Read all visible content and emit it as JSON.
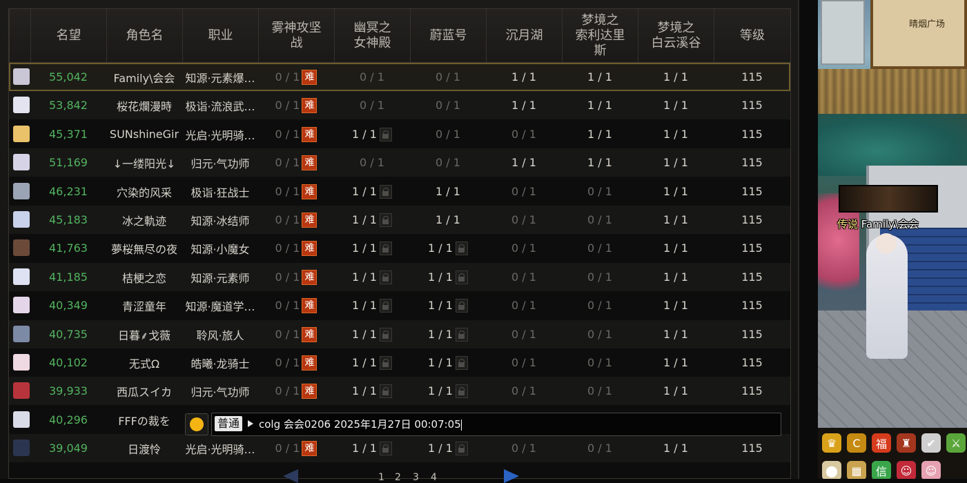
{
  "table": {
    "headers": [
      {
        "key": "avatar",
        "label": ""
      },
      {
        "key": "fame",
        "label": "名望"
      },
      {
        "key": "name",
        "label": "角色名"
      },
      {
        "key": "job",
        "label": "职业"
      },
      {
        "key": "d1",
        "label": "雾神攻坚\n战"
      },
      {
        "key": "d2",
        "label": "幽冥之\n女神殿"
      },
      {
        "key": "d3",
        "label": "蔚蓝号"
      },
      {
        "key": "d4",
        "label": "沉月湖"
      },
      {
        "key": "d5",
        "label": "梦境之\n索利达里\n斯"
      },
      {
        "key": "d6",
        "label": "梦境之\n白云溪谷"
      },
      {
        "key": "level",
        "label": "等级"
      }
    ],
    "rows": [
      {
        "fame": "55,042",
        "name": "Family\\会会",
        "job": "知源·元素爆…",
        "d1": "0 / 1",
        "d1_badge": "hard",
        "d2": "0 / 1",
        "d2_badge": "",
        "d3": "0 / 1",
        "d3_badge": "",
        "d4": "1 / 1",
        "d4_badge": "",
        "d5": "1 / 1",
        "d6": "1 / 1",
        "level": "115",
        "avatar_color": "#c9c6d6",
        "selected": true
      },
      {
        "fame": "53,842",
        "name": "桜花爛漫時",
        "job": "极诣·流浪武…",
        "d1": "0 / 1",
        "d1_badge": "hard",
        "d2": "0 / 1",
        "d2_badge": "",
        "d3": "0 / 1",
        "d3_badge": "",
        "d4": "1 / 1",
        "d4_badge": "",
        "d5": "1 / 1",
        "d6": "1 / 1",
        "level": "115",
        "avatar_color": "#e3e4ef"
      },
      {
        "fame": "45,371",
        "name": "SUNshineGir",
        "job": "光启·光明骑…",
        "d1": "0 / 1",
        "d1_badge": "hard",
        "d2": "1 / 1",
        "d2_badge": "lock",
        "d3": "0 / 1",
        "d3_badge": "",
        "d4": "0 / 1",
        "d4_badge": "",
        "d5": "1 / 1",
        "d6": "1 / 1",
        "level": "115",
        "avatar_color": "#e9c26a"
      },
      {
        "fame": "51,169",
        "name": "↓一缕阳光↓",
        "job": "归元·气功师",
        "d1": "0 / 1",
        "d1_badge": "hard",
        "d2": "0 / 1",
        "d2_badge": "",
        "d3": "0 / 1",
        "d3_badge": "",
        "d4": "1 / 1",
        "d4_badge": "",
        "d5": "1 / 1",
        "d6": "1 / 1",
        "level": "115",
        "avatar_color": "#d7d3e6"
      },
      {
        "fame": "46,231",
        "name": "穴染的风采",
        "job": "极诣·狂战士",
        "d1": "0 / 1",
        "d1_badge": "hard",
        "d2": "1 / 1",
        "d2_badge": "lock",
        "d3": "1 / 1",
        "d3_badge": "",
        "d4": "0 / 1",
        "d4_badge": "",
        "d5": "0 / 1",
        "d6": "1 / 1",
        "level": "115",
        "avatar_color": "#9aa4b5"
      },
      {
        "fame": "45,183",
        "name": "冰之軌迹",
        "job": "知源·冰结师",
        "d1": "0 / 1",
        "d1_badge": "hard",
        "d2": "1 / 1",
        "d2_badge": "lock",
        "d3": "1 / 1",
        "d3_badge": "",
        "d4": "0 / 1",
        "d4_badge": "",
        "d5": "0 / 1",
        "d6": "1 / 1",
        "level": "115",
        "avatar_color": "#c8d2ea"
      },
      {
        "fame": "41,763",
        "name": "夢桜無尽の夜",
        "job": "知源·小魔女",
        "d1": "0 / 1",
        "d1_badge": "hard",
        "d2": "1 / 1",
        "d2_badge": "lock",
        "d3": "1 / 1",
        "d3_badge": "lock",
        "d4": "0 / 1",
        "d4_badge": "",
        "d5": "0 / 1",
        "d6": "1 / 1",
        "level": "115",
        "avatar_color": "#6b4a3a"
      },
      {
        "fame": "41,185",
        "name": "桔梗之恋",
        "job": "知源·元素师",
        "d1": "0 / 1",
        "d1_badge": "hard",
        "d2": "1 / 1",
        "d2_badge": "lock",
        "d3": "1 / 1",
        "d3_badge": "lock",
        "d4": "0 / 1",
        "d4_badge": "",
        "d5": "0 / 1",
        "d6": "1 / 1",
        "level": "115",
        "avatar_color": "#dfe2f2"
      },
      {
        "fame": "40,349",
        "name": "青涩童年",
        "job": "知源·魔道学…",
        "d1": "0 / 1",
        "d1_badge": "hard",
        "d2": "1 / 1",
        "d2_badge": "lock",
        "d3": "1 / 1",
        "d3_badge": "lock",
        "d4": "0 / 1",
        "d4_badge": "",
        "d5": "0 / 1",
        "d6": "1 / 1",
        "level": "115",
        "avatar_color": "#e4d6e8"
      },
      {
        "fame": "40,735",
        "name": "日暮⸙戈薇",
        "job": "聆风·旅人",
        "d1": "0 / 1",
        "d1_badge": "hard",
        "d2": "1 / 1",
        "d2_badge": "lock",
        "d3": "1 / 1",
        "d3_badge": "lock",
        "d4": "0 / 1",
        "d4_badge": "",
        "d5": "0 / 1",
        "d6": "1 / 1",
        "level": "115",
        "avatar_color": "#7d8aa6"
      },
      {
        "fame": "40,102",
        "name": "无式Ω",
        "job": "皓曦·龙骑士",
        "d1": "0 / 1",
        "d1_badge": "hard",
        "d2": "1 / 1",
        "d2_badge": "lock",
        "d3": "1 / 1",
        "d3_badge": "lock",
        "d4": "0 / 1",
        "d4_badge": "",
        "d5": "0 / 1",
        "d6": "1 / 1",
        "level": "115",
        "avatar_color": "#efd9e2"
      },
      {
        "fame": "39,933",
        "name": "西瓜スイカ",
        "job": "归元·气功师",
        "d1": "0 / 1",
        "d1_badge": "hard",
        "d2": "1 / 1",
        "d2_badge": "lock",
        "d3": "1 / 1",
        "d3_badge": "lock",
        "d4": "0 / 1",
        "d4_badge": "",
        "d5": "0 / 1",
        "d6": "1 / 1",
        "level": "115",
        "avatar_color": "#b8343c"
      },
      {
        "fame": "40,296",
        "name": "FFFの裁を",
        "job": "",
        "d1": "",
        "d1_badge": "",
        "d2": "",
        "d2_badge": "",
        "d3": "",
        "d3_badge": "",
        "d4": "",
        "d4_badge": "",
        "d5": "",
        "d6": "",
        "level": "",
        "avatar_color": "#d9dbe8"
      },
      {
        "fame": "39,049",
        "name": "日渡怜",
        "job": "光启·光明骑…",
        "d1": "0 / 1",
        "d1_badge": "hard",
        "d2": "1 / 1",
        "d2_badge": "lock",
        "d3": "1 / 1",
        "d3_badge": "lock",
        "d4": "0 / 1",
        "d4_badge": "",
        "d5": "0 / 1",
        "d6": "1 / 1",
        "level": "115",
        "avatar_color": "#2b3550"
      }
    ],
    "hard_label": "难"
  },
  "chat": {
    "channel": "普通",
    "text": "colg 会会0206 2025年1月27日 00:07:05"
  },
  "pager": {
    "pages": [
      "1",
      "2",
      "3",
      "4"
    ]
  },
  "game": {
    "minimap_label": "晴烟广场",
    "player_title": "传说",
    "player_name": "Family\\会会",
    "hud_icons": [
      {
        "name": "crown-icon",
        "glyph": "♛",
        "color": "#d9a21a"
      },
      {
        "name": "coin-c-icon",
        "glyph": "C",
        "color": "#c58a12"
      },
      {
        "name": "fortune-icon",
        "glyph": "福",
        "color": "#d63b1c"
      },
      {
        "name": "chest-icon",
        "glyph": "♜",
        "color": "#a4361e"
      },
      {
        "name": "quest-check-icon",
        "glyph": "✔",
        "color": "#cfcfcf"
      },
      {
        "name": "sword-icon",
        "glyph": "⚔",
        "color": "#5aa63a"
      },
      {
        "name": "location-pin-icon",
        "glyph": "⬤",
        "color": "#d8c9a0"
      },
      {
        "name": "menu-grid-icon",
        "glyph": "▦",
        "color": "#c9a34f"
      },
      {
        "name": "letter-icon",
        "glyph": "信",
        "color": "#3aa64b"
      },
      {
        "name": "character-portrait-icon",
        "glyph": "☺",
        "color": "#c22a3a"
      },
      {
        "name": "pet-portrait-icon",
        "glyph": "☺",
        "color": "#e6a2b2"
      }
    ]
  }
}
